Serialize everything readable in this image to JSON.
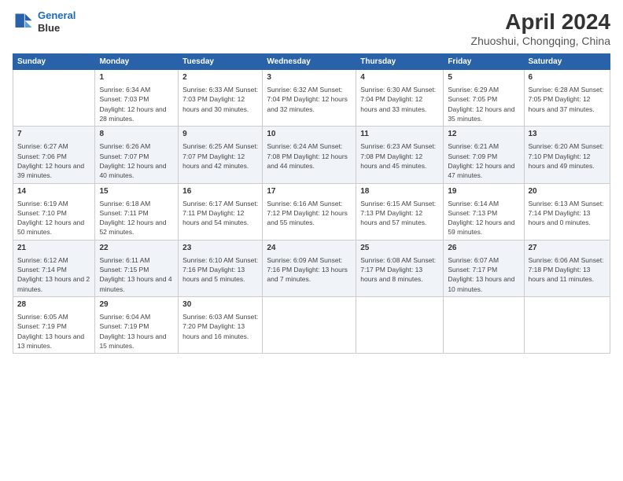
{
  "header": {
    "logo_line1": "General",
    "logo_line2": "Blue",
    "title": "April 2024",
    "subtitle": "Zhuoshui, Chongqing, China"
  },
  "days_of_week": [
    "Sunday",
    "Monday",
    "Tuesday",
    "Wednesday",
    "Thursday",
    "Friday",
    "Saturday"
  ],
  "weeks": [
    [
      {
        "day": "",
        "text": ""
      },
      {
        "day": "1",
        "text": "Sunrise: 6:34 AM\nSunset: 7:03 PM\nDaylight: 12 hours\nand 28 minutes."
      },
      {
        "day": "2",
        "text": "Sunrise: 6:33 AM\nSunset: 7:03 PM\nDaylight: 12 hours\nand 30 minutes."
      },
      {
        "day": "3",
        "text": "Sunrise: 6:32 AM\nSunset: 7:04 PM\nDaylight: 12 hours\nand 32 minutes."
      },
      {
        "day": "4",
        "text": "Sunrise: 6:30 AM\nSunset: 7:04 PM\nDaylight: 12 hours\nand 33 minutes."
      },
      {
        "day": "5",
        "text": "Sunrise: 6:29 AM\nSunset: 7:05 PM\nDaylight: 12 hours\nand 35 minutes."
      },
      {
        "day": "6",
        "text": "Sunrise: 6:28 AM\nSunset: 7:05 PM\nDaylight: 12 hours\nand 37 minutes."
      }
    ],
    [
      {
        "day": "7",
        "text": "Sunrise: 6:27 AM\nSunset: 7:06 PM\nDaylight: 12 hours\nand 39 minutes."
      },
      {
        "day": "8",
        "text": "Sunrise: 6:26 AM\nSunset: 7:07 PM\nDaylight: 12 hours\nand 40 minutes."
      },
      {
        "day": "9",
        "text": "Sunrise: 6:25 AM\nSunset: 7:07 PM\nDaylight: 12 hours\nand 42 minutes."
      },
      {
        "day": "10",
        "text": "Sunrise: 6:24 AM\nSunset: 7:08 PM\nDaylight: 12 hours\nand 44 minutes."
      },
      {
        "day": "11",
        "text": "Sunrise: 6:23 AM\nSunset: 7:08 PM\nDaylight: 12 hours\nand 45 minutes."
      },
      {
        "day": "12",
        "text": "Sunrise: 6:21 AM\nSunset: 7:09 PM\nDaylight: 12 hours\nand 47 minutes."
      },
      {
        "day": "13",
        "text": "Sunrise: 6:20 AM\nSunset: 7:10 PM\nDaylight: 12 hours\nand 49 minutes."
      }
    ],
    [
      {
        "day": "14",
        "text": "Sunrise: 6:19 AM\nSunset: 7:10 PM\nDaylight: 12 hours\nand 50 minutes."
      },
      {
        "day": "15",
        "text": "Sunrise: 6:18 AM\nSunset: 7:11 PM\nDaylight: 12 hours\nand 52 minutes."
      },
      {
        "day": "16",
        "text": "Sunrise: 6:17 AM\nSunset: 7:11 PM\nDaylight: 12 hours\nand 54 minutes."
      },
      {
        "day": "17",
        "text": "Sunrise: 6:16 AM\nSunset: 7:12 PM\nDaylight: 12 hours\nand 55 minutes."
      },
      {
        "day": "18",
        "text": "Sunrise: 6:15 AM\nSunset: 7:13 PM\nDaylight: 12 hours\nand 57 minutes."
      },
      {
        "day": "19",
        "text": "Sunrise: 6:14 AM\nSunset: 7:13 PM\nDaylight: 12 hours\nand 59 minutes."
      },
      {
        "day": "20",
        "text": "Sunrise: 6:13 AM\nSunset: 7:14 PM\nDaylight: 13 hours\nand 0 minutes."
      }
    ],
    [
      {
        "day": "21",
        "text": "Sunrise: 6:12 AM\nSunset: 7:14 PM\nDaylight: 13 hours\nand 2 minutes."
      },
      {
        "day": "22",
        "text": "Sunrise: 6:11 AM\nSunset: 7:15 PM\nDaylight: 13 hours\nand 4 minutes."
      },
      {
        "day": "23",
        "text": "Sunrise: 6:10 AM\nSunset: 7:16 PM\nDaylight: 13 hours\nand 5 minutes."
      },
      {
        "day": "24",
        "text": "Sunrise: 6:09 AM\nSunset: 7:16 PM\nDaylight: 13 hours\nand 7 minutes."
      },
      {
        "day": "25",
        "text": "Sunrise: 6:08 AM\nSunset: 7:17 PM\nDaylight: 13 hours\nand 8 minutes."
      },
      {
        "day": "26",
        "text": "Sunrise: 6:07 AM\nSunset: 7:17 PM\nDaylight: 13 hours\nand 10 minutes."
      },
      {
        "day": "27",
        "text": "Sunrise: 6:06 AM\nSunset: 7:18 PM\nDaylight: 13 hours\nand 11 minutes."
      }
    ],
    [
      {
        "day": "28",
        "text": "Sunrise: 6:05 AM\nSunset: 7:19 PM\nDaylight: 13 hours\nand 13 minutes."
      },
      {
        "day": "29",
        "text": "Sunrise: 6:04 AM\nSunset: 7:19 PM\nDaylight: 13 hours\nand 15 minutes."
      },
      {
        "day": "30",
        "text": "Sunrise: 6:03 AM\nSunset: 7:20 PM\nDaylight: 13 hours\nand 16 minutes."
      },
      {
        "day": "",
        "text": ""
      },
      {
        "day": "",
        "text": ""
      },
      {
        "day": "",
        "text": ""
      },
      {
        "day": "",
        "text": ""
      }
    ]
  ]
}
